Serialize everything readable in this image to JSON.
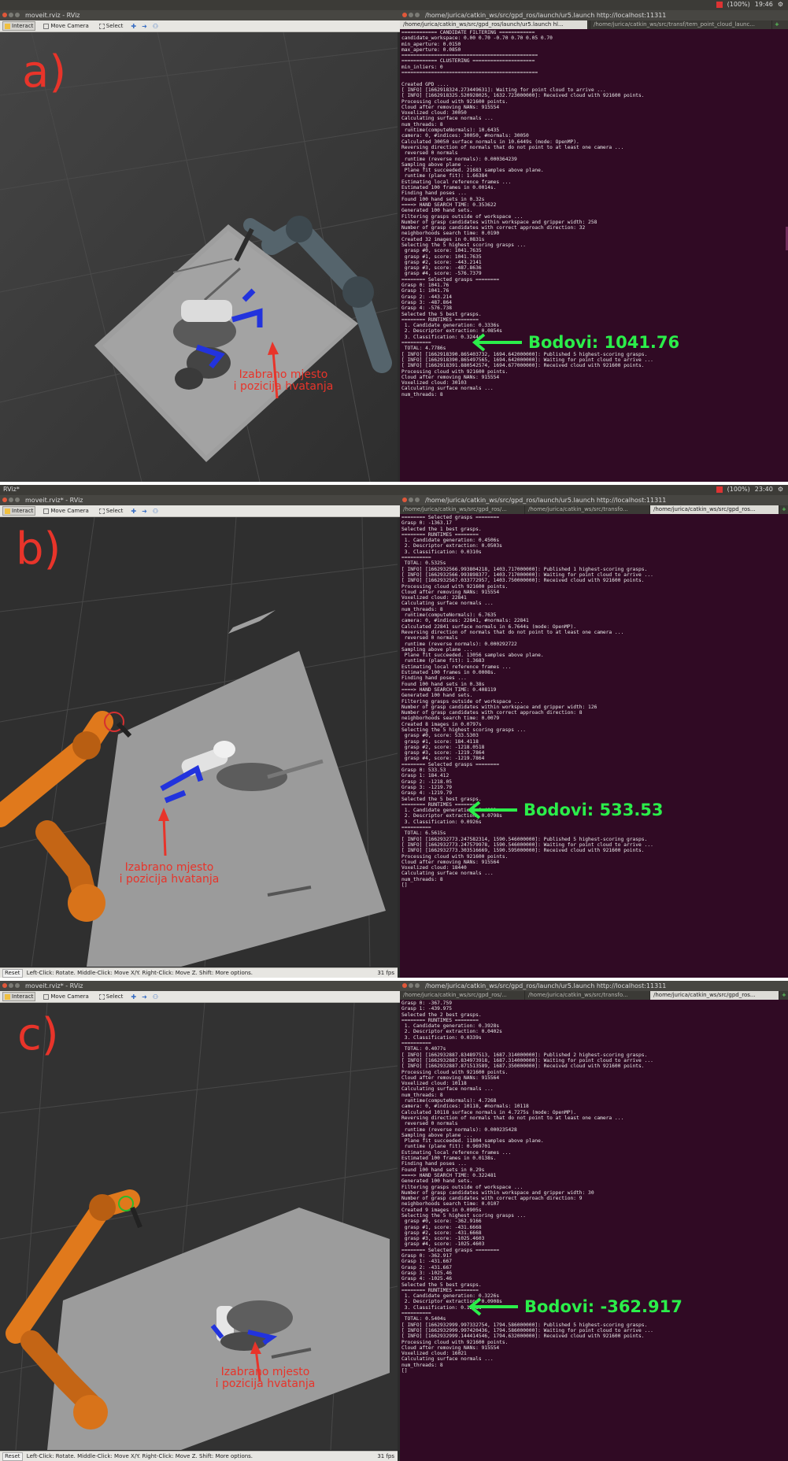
{
  "panels": [
    {
      "label": "a)",
      "system_bar": {
        "app_name": "",
        "battery": "(100%)",
        "time": "19:46"
      },
      "rviz": {
        "title": "moveit.rviz - RViz",
        "toolbar": {
          "interact": "Interact",
          "move_camera": "Move Camera",
          "select": "Select"
        },
        "status_text": "",
        "fps": "",
        "annotation": [
          "Izabrano mjesto",
          "i pozicija hvatanja"
        ]
      },
      "terminal": {
        "title": "/home/jurica/catkin_ws/src/gpd_ros/launch/ur5.launch http://localhost:11311",
        "tabs": [
          "/home/jurica/catkin_ws/src/gpd_ros/launch/ur5.launch hl...",
          "/home/jurica/catkin_ws/src/trans...",
          "/home/jurica/catkin_ws/src/transf/tem_point_cloud_launc..."
        ],
        "active_tab": 0,
        "lines": [
          "============ CANDIDATE FILTERING ============",
          "candidate_workspace: 0.00 0.70 -0.70 0.70 0.05 0.70",
          "min_aperture: 0.0150",
          "max_aperture: 0.0850",
          "==============================================",
          "============ CLUSTERING =====================",
          "min_inliers: 0",
          "==============================================",
          "",
          "Created GPD ....",
          "[ INFO] [1662918324.273449631]: Waiting for point cloud to arrive ...",
          "[ INFO] [1662918325.520928025, 1632.723000000]: Received cloud with 921600 points.",
          "Processing cloud with 921600 points.",
          "Cloud after removing NANs: 915554",
          "Voxelized cloud: 30050",
          "Calculating surface normals ...",
          "num_threads: 8",
          " runtime(computeNormals): 10.6435",
          "camera: 0, #indices: 30050, #normals: 30050",
          "Calculated 30050 surface normals in 10.6449s (mode: OpenMP).",
          "Reversing direction of normals that do not point to at least one camera ...",
          " reversed 0 normals",
          " runtime (reverse normals): 0.000364239",
          "Sampling above plane ...",
          " Plane fit succeeded. 21683 samples above plane.",
          " runtime (plane fit): 1.66384",
          "Estimating local reference frames ...",
          "Estimated 100 frames in 0.0014s.",
          "Finding hand poses ...",
          "Found 100 hand sets in 0.32s",
          "====> HAND SEARCH TIME: 0.353622",
          "Generated 100 hand sets.",
          "Filtering grasps outside of workspace ...",
          "Number of grasp candidates within workspace and gripper width: 258",
          "Number of grasp candidates with correct approach direction: 32",
          "neighborhoods search time: 0.0190",
          "Created 32 images in 0.0831s",
          "Selecting the 5 highest scoring grasps ...",
          " grasp #0, score: 1041.7635",
          " grasp #1, score: 1041.7635",
          " grasp #2, score: -443.2141",
          " grasp #3, score: -487.8636",
          " grasp #4, score: -576.7379",
          "======== Selected grasps ========",
          "Grasp 0: 1041.76",
          "Grasp 1: 1041.76",
          "Grasp 2: -443.214",
          "Grasp 3: -487.864",
          "Grasp 4: -576.738",
          "Selected the 5 best grasps.",
          "======== RUNTIMES ========",
          " 1. Candidate generation: 0.3336s",
          " 2. Descriptor extraction: 0.0854s",
          " 3. Classification: 0.3244s",
          "==========",
          " TOTAL: 4.7786s",
          "[ INFO] [1662918390.865403732, 1694.642000000]: Published 5 highest-scoring grasps.",
          "[ INFO] [1662918390.865497565, 1694.642000000]: Waiting for point cloud to arrive ...",
          "[ INFO] [1662918391.880542574, 1694.677000000]: Received cloud with 921600 points.",
          "Processing cloud with 921600 points.",
          "Cloud after removing NANs: 915554",
          "Voxelized cloud: 30103",
          "Calculating surface normals ...",
          "num_threads: 8"
        ]
      },
      "score_label": "Bodovi: 1041.76"
    },
    {
      "label": "b)",
      "system_bar": {
        "app_name": "RViz*",
        "battery": "(100%)",
        "time": "23:40"
      },
      "rviz": {
        "title": "moveit.rviz* - RViz",
        "toolbar": {
          "interact": "Interact",
          "move_camera": "Move Camera",
          "select": "Select"
        },
        "status_text": "Left-Click: Rotate. Middle-Click: Move X/Y. Right-Click: Move Z. Shift: More options.",
        "fps": "31 fps",
        "reset": "Reset",
        "annotation": [
          "Izabrano mjesto",
          "i pozicija hvatanja"
        ]
      },
      "terminal": {
        "title": "/home/jurica/catkin_ws/src/gpd_ros/launch/ur5.launch http://localhost:11311",
        "tabs": [
          "/home/jurica/catkin_ws/src/gpd_ros/...",
          "/home/jurica/catkin_ws/src/transfo...",
          "/home/jurica/catkin_ws/src/gpd_ros..."
        ],
        "active_tab": 2,
        "lines": [
          "======== Selected grasps ========",
          "Grasp 0: -1363.17",
          "Selected the 1 best grasps.",
          "======== RUNTIMES ========",
          " 1. Candidate generation: 0.4506s",
          " 2. Descriptor extraction: 0.0503s",
          " 3. Classification: 0.0310s",
          "==========",
          " TOTAL: 0.5325s",
          "[ INFO] [1662932566.993804218, 1403.717000000]: Published 1 highest-scoring grasps.",
          "[ INFO] [1662932566.993898377, 1403.717000000]: Waiting for point cloud to arrive ...",
          "[ INFO] [1662932567.033772957, 1403.750000000]: Received cloud with 921600 points.",
          "Processing cloud with 921600 points.",
          "Cloud after removing NANs: 915554",
          "Voxelized cloud: 22841",
          "Calculating surface normals ...",
          "num_threads: 8",
          " runtime(computeNormals): 6.7635",
          "camera: 0, #indices: 22841, #normals: 22841",
          "Calculated 22841 surface normals in 6.7644s (mode: OpenMP).",
          "Reversing direction of normals that do not point to at least one camera ...",
          " reversed 0 normals",
          " runtime (reverse normals): 0.000292722",
          "Sampling above plane ...",
          " Plane fit succeeded. 13056 samples above plane.",
          " runtime (plane fit): 1.3683",
          "Estimating local reference frames ...",
          "Estimated 100 frames in 0.0008s.",
          "Finding hand poses ...",
          "Found 100 hand sets in 0.38s",
          "====> HAND SEARCH TIME: 0.408119",
          "Generated 100 hand sets.",
          "Filtering grasps outside of workspace ...",
          "Number of grasp candidates within workspace and gripper width: 126",
          "Number of grasp candidates with correct approach direction: 8",
          "neighborhoods search time: 0.0079",
          "Created 8 images in 0.0797s",
          "Selecting the 5 highest scoring grasps ...",
          " grasp #0, score: 533.5303",
          " grasp #1, score: 184.4118",
          " grasp #2, score: -1218.0518",
          " grasp #3, score: -1219.7864",
          " grasp #4, score: -1219.7864",
          "======== Selected grasps ========",
          "Grasp 0: 533.53",
          "Grasp 1: 184.412",
          "Grasp 2: -1218.05",
          "Grasp 3: -1219.79",
          "Grasp 4: -1219.79",
          "Selected the 5 best grasps.",
          "======== RUNTIMES ========",
          " 1. Candidate generation: 0.4082s",
          " 2. Descriptor extraction: 0.0798s",
          " 3. Classification: 0.0926s",
          "==========",
          " TOTAL: 6.5615s",
          "[ INFO] [1662932773.247582314, 1590.546000000]: Published 5 highest-scoring grasps.",
          "[ INFO] [1662932773.247579978, 1590.546000000]: Waiting for point cloud to arrive ...",
          "[ INFO] [1662932773.303516669, 1590.595000000]: Received cloud with 921600 points.",
          "Processing cloud with 921600 points.",
          "Cloud after removing NANs: 915564",
          "Voxelized cloud: 18440",
          "Calculating surface normals ...",
          "num_threads: 8",
          "[]"
        ]
      },
      "score_label": "Bodovi: 533.53"
    },
    {
      "label": "c)",
      "system_bar": {
        "app_name": "",
        "battery": "",
        "time": ""
      },
      "rviz": {
        "title": "moveit.rviz* - RViz",
        "toolbar": {
          "interact": "Interact",
          "move_camera": "Move Camera",
          "select": "Select"
        },
        "status_text": "Left-Click: Rotate. Middle-Click: Move X/Y. Right-Click: Move Z. Shift: More options.",
        "fps": "31 fps",
        "reset": "Reset",
        "annotation": [
          "Izabrano mjesto",
          "i pozicija hvatanja"
        ]
      },
      "terminal": {
        "title": "/home/jurica/catkin_ws/src/gpd_ros/launch/ur5.launch http://localhost:11311",
        "tabs": [
          "/home/jurica/catkin_ws/src/gpd_ros/...",
          "/home/jurica/catkin_ws/src/transfo...",
          "/home/jurica/catkin_ws/src/gpd_ros..."
        ],
        "active_tab": 2,
        "lines": [
          "Grasp 0: -367.759",
          "Grasp 1: -439.975",
          "Selected the 2 best grasps.",
          "======== RUNTIMES ========",
          " 1. Candidate generation: 0.3928s",
          " 2. Descriptor extraction: 0.0402s",
          " 3. Classification: 0.0339s",
          "==========",
          " TOTAL: 0.4077s",
          "[ INFO] [1662932887.834897513, 1687.314000000]: Published 2 highest-scoring grasps.",
          "[ INFO] [1662932887.834973918, 1687.314000000]: Waiting for point cloud to arrive ...",
          "[ INFO] [1662932887.871513589, 1687.350000000]: Received cloud with 921600 points.",
          "Processing cloud with 921600 points.",
          "Cloud after removing NANs: 915564",
          "Voxelized cloud: 10118",
          "Calculating surface normals ...",
          "num_threads: 8",
          " runtime(computeNormals): 4.7268",
          "camera: 0, #indices: 10118, #normals: 10118",
          "Calculated 10118 surface normals in 4.7275s (mode: OpenMP).",
          "Reversing direction of normals that do not point to at least one camera ...",
          " reversed 0 normals",
          " runtime (reverse normals): 0.000235428",
          "Sampling above plane ...",
          " Plane fit succeeded. 11804 samples above plane.",
          " runtime (plane fit): 0.969701",
          "Estimating local reference frames ...",
          "Estimated 100 frames in 0.0138s.",
          "Finding hand poses ...",
          "Found 100 hand sets in 0.29s",
          "====> HAND SEARCH TIME: 0.322481",
          "Generated 100 hand sets.",
          "Filtering grasps outside of workspace ...",
          "Number of grasp candidates within workspace and gripper width: 30",
          "Number of grasp candidates with correct approach direction: 9",
          "neighborhoods search time: 0.0107",
          "Created 9 images in 0.0905s",
          "Selecting the 5 highest scoring grasps ...",
          " grasp #0, score: -362.9166",
          " grasp #1, score: -431.6668",
          " grasp #2, score: -431.6668",
          " grasp #3, score: -1025.4603",
          " grasp #4, score: -1025.4603",
          "======== Selected grasps ========",
          "Grasp 0: -362.917",
          "Grasp 1: -431.667",
          "Grasp 2: -431.667",
          "Grasp 3: -1025.46",
          "Grasp 4: -1025.46",
          "Selected the 5 best grasps.",
          "======== RUNTIMES ========",
          " 1. Candidate generation: 0.3226s",
          " 2. Descriptor extraction: 0.0908s",
          " 3. Classification: 0.1248s",
          "==========",
          " TOTAL: 0.5404s",
          "[ INFO] [1662932999.997332754, 1794.586000000]: Published 5 highest-scoring grasps.",
          "[ INFO] [1662932999.997420436, 1794.586000000]: Waiting for point cloud to arrive ...",
          "[ INFO] [1662932999.144414546, 1794.632000000]: Received cloud with 921600 points.",
          "Processing cloud with 921600 points.",
          "Cloud after removing NANs: 915554",
          "Voxelized cloud: 16021",
          "Calculating surface normals ...",
          "num_threads: 8",
          "[]"
        ]
      },
      "score_label": "Bodovi: -362.917"
    }
  ],
  "colors": {
    "terminal_bg": "#300a24",
    "score_green": "#2bee4a",
    "annotation_red": "#e8342a",
    "robot_orange": "#e0791c",
    "robot_gray": "#5c6a72"
  }
}
